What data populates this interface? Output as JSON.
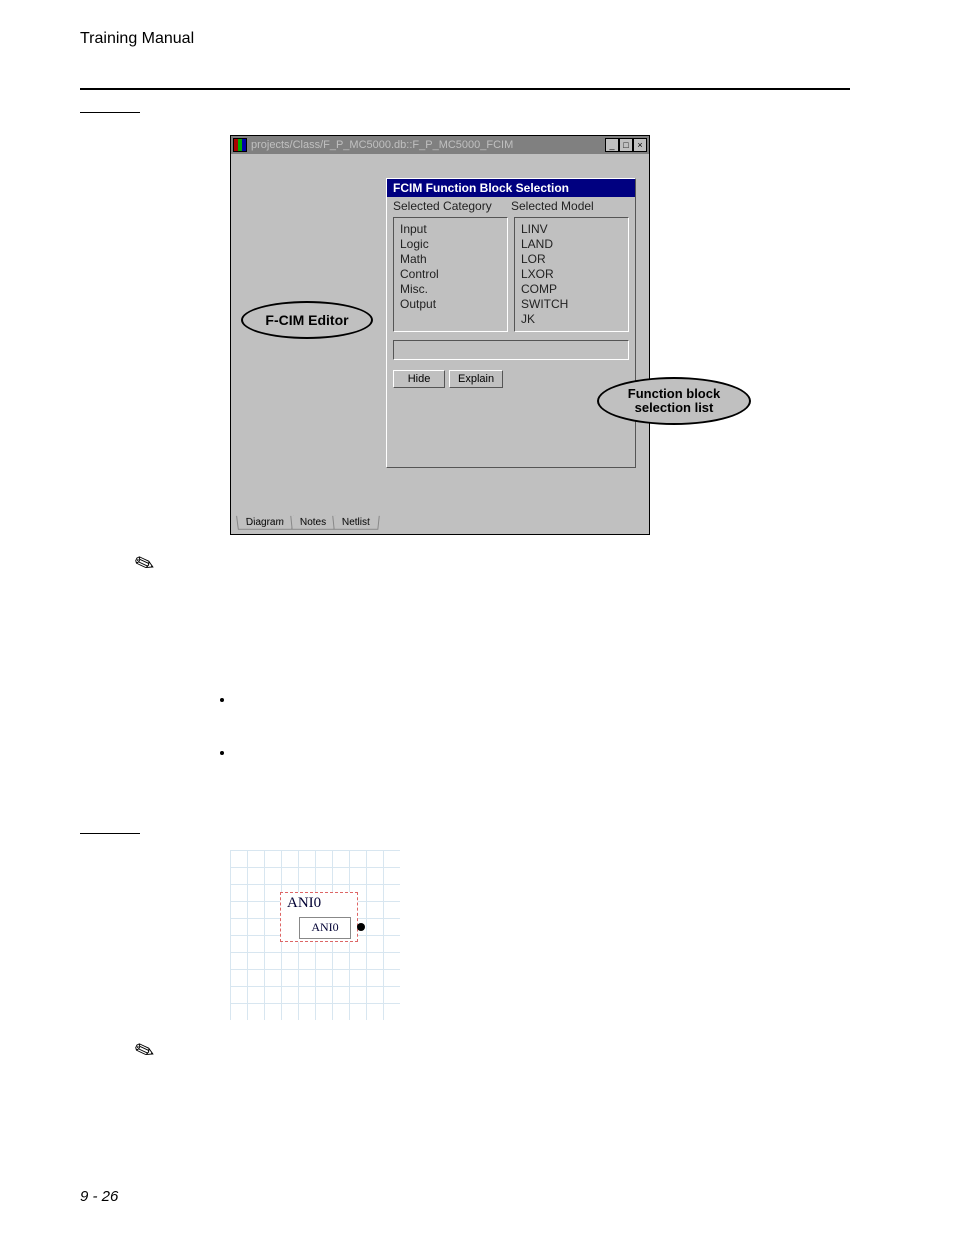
{
  "header": {
    "title": "Training Manual"
  },
  "section_labels": {
    "l112": "",
    "l830": ""
  },
  "window": {
    "title": "projects/Class/F_P_MC5000.db::F_P_MC5000_FCIM",
    "wbuttons": {
      "min": "_",
      "max": "□",
      "close": "×"
    },
    "dlg_title": "FCIM Function Block Selection",
    "col_category": "Selected Category",
    "col_model": "Selected Model",
    "categories": [
      "Input",
      "Logic",
      "Math",
      "Control",
      "Misc.",
      "Output"
    ],
    "models": [
      "LINV",
      "LAND",
      "LOR",
      "LXOR",
      "COMP",
      "SWITCH",
      "JK"
    ],
    "hide_label": "Hide",
    "explain_label": "Explain",
    "tabs": [
      "Diagram",
      "Notes",
      "Netlist"
    ],
    "annot_fcim": "F-CIM Editor",
    "annot_funcblock": "Function block\nselection list"
  },
  "notes": {
    "n1": "",
    "bullets": [
      "",
      ""
    ],
    "n2": ""
  },
  "gridfig": {
    "outer_label": "ANI0",
    "inner_label": "ANI0"
  },
  "page_number": "9 - 26"
}
